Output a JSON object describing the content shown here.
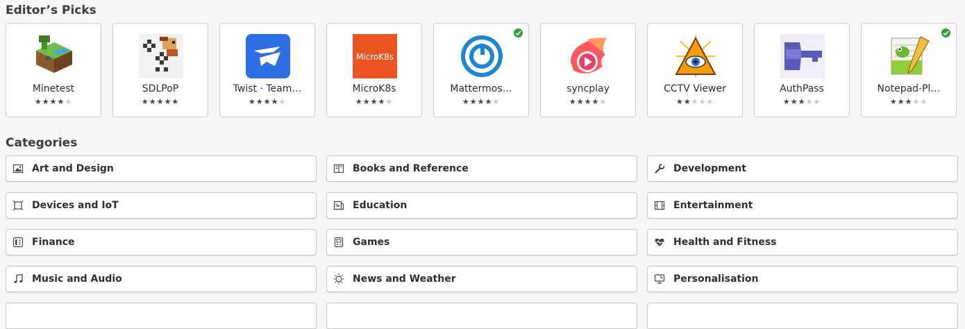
{
  "editors_picks": {
    "title": "Editor’s Picks",
    "apps": [
      {
        "name": "Minetest",
        "rating": 4,
        "installed": false,
        "icon": "minetest-icon"
      },
      {
        "name": "SDLPoP",
        "rating": 5,
        "installed": false,
        "icon": "sdlpop-icon"
      },
      {
        "name": "Twist · Team…",
        "rating": 4,
        "installed": false,
        "icon": "twist-icon"
      },
      {
        "name": "MicroK8s",
        "rating": 4,
        "installed": false,
        "icon": "microk8s-icon",
        "icon_text": "MicroK8s"
      },
      {
        "name": "Mattermos…",
        "rating": 4,
        "installed": true,
        "icon": "mattermost-icon"
      },
      {
        "name": "syncplay",
        "rating": 4,
        "installed": false,
        "icon": "syncplay-icon"
      },
      {
        "name": "CCTV Viewer",
        "rating": 2,
        "installed": false,
        "icon": "cctv-viewer-icon"
      },
      {
        "name": "AuthPass",
        "rating": 3,
        "installed": false,
        "icon": "authpass-icon"
      },
      {
        "name": "Notepad-Pl…",
        "rating": 3,
        "installed": true,
        "icon": "notepad-plus-plus-icon"
      }
    ]
  },
  "categories": {
    "title": "Categories",
    "items": [
      {
        "label": "Art and Design",
        "icon": "art-image-icon"
      },
      {
        "label": "Books and Reference",
        "icon": "book-icon"
      },
      {
        "label": "Development",
        "icon": "wrench-icon"
      },
      {
        "label": "Devices and IoT",
        "icon": "device-frame-icon"
      },
      {
        "label": "Education",
        "icon": "education-icon"
      },
      {
        "label": "Entertainment",
        "icon": "film-icon"
      },
      {
        "label": "Finance",
        "icon": "calculator-icon"
      },
      {
        "label": "Games",
        "icon": "gamepad-icon"
      },
      {
        "label": "Health and Fitness",
        "icon": "heart-pulse-icon"
      },
      {
        "label": "Music and Audio",
        "icon": "music-note-icon"
      },
      {
        "label": "News and Weather",
        "icon": "sun-icon"
      },
      {
        "label": "Personalisation",
        "icon": "monitor-icon"
      }
    ]
  },
  "colors": {
    "installed_badge": "#2f9f3b",
    "microk8s": "#e95420",
    "twist": "#2f6fe6",
    "mattermost": "#1e86d0"
  }
}
